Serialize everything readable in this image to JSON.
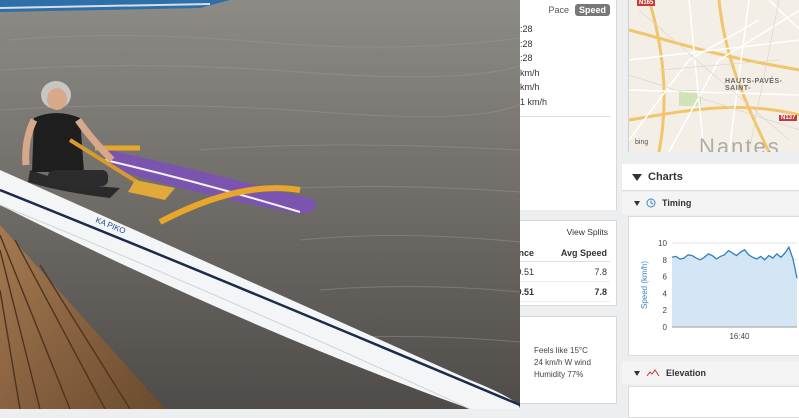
{
  "stats": {
    "toggle_pace": "Pace",
    "toggle_speed": "Speed",
    "rows": [
      ":28",
      ":28",
      ":28",
      "km/h",
      "km/h",
      "1 km/h"
    ]
  },
  "laps": {
    "view_splits": "View Splits",
    "columns": [
      "ance",
      "Avg Speed"
    ],
    "rows": [
      {
        "distance": "9.51",
        "avg_speed": "7.8"
      },
      {
        "distance": "9.51",
        "avg_speed": "7.8"
      }
    ]
  },
  "weather": {
    "lines": [
      "Feels like 15°C",
      "24 km/h W wind",
      "Humidity 77%"
    ]
  },
  "map": {
    "town_label": "HAUTS-PAVÉS-SAINT-",
    "big_label": "Nantes",
    "route_signs": [
      "N165",
      "N137"
    ],
    "provider": "bing"
  },
  "charts": {
    "title": "Charts",
    "timing_title": "Timing",
    "elevation_title": "Elevation"
  },
  "colors": {
    "line": "#2f7fc1",
    "fill": "#cfe3f5",
    "axis_label": "#3a86c8"
  },
  "chart_data": {
    "type": "area",
    "title": "",
    "xlabel": "",
    "ylabel": "Speed (km/h)",
    "ylim": [
      0,
      10
    ],
    "yticks": [
      0,
      2,
      4,
      6,
      8,
      10
    ],
    "xtick_labels": [
      "16:40"
    ],
    "grid": true,
    "series": [
      {
        "values": [
          8.3,
          8.4,
          8.1,
          8.2,
          8.6,
          8.5,
          8.2,
          8.0,
          8.3,
          8.7,
          8.5,
          8.1,
          8.4,
          8.6,
          9.1,
          8.8,
          8.5,
          8.9,
          9.2,
          8.6,
          8.3,
          8.1,
          8.4,
          8.0,
          8.5,
          8.2,
          8.7,
          8.3,
          8.8,
          9.5,
          8.1,
          5.8
        ]
      }
    ]
  }
}
